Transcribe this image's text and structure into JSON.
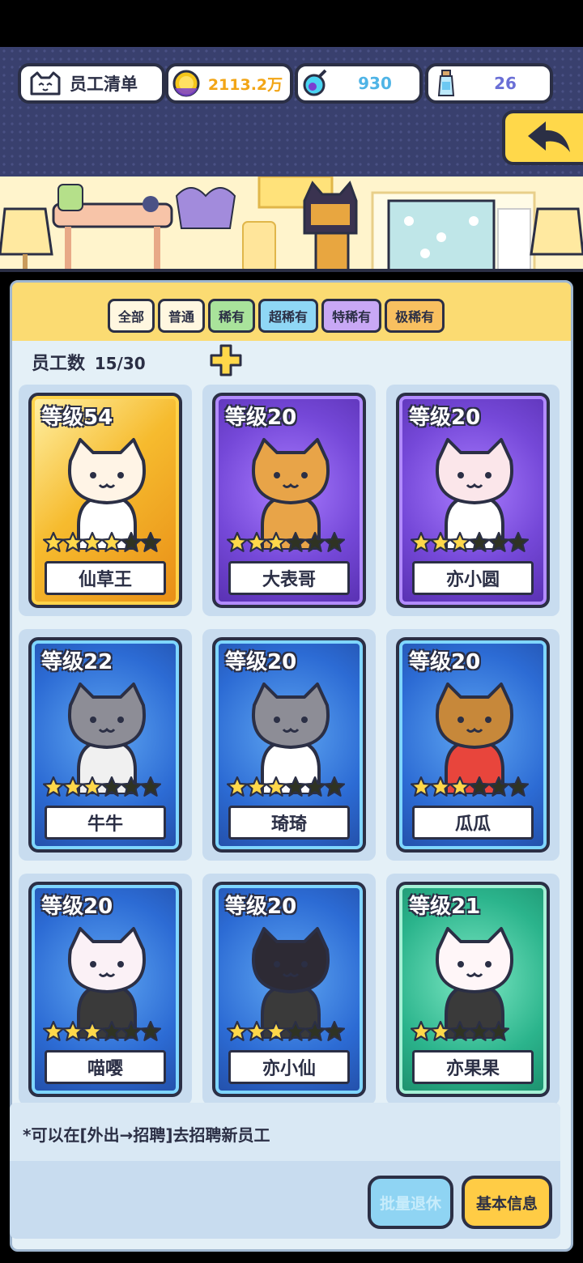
{
  "header": {
    "title": "员工清单",
    "gold": "2113.2万",
    "gems": "930",
    "bottles": "26"
  },
  "tabs": [
    {
      "label": "全部",
      "color": "#fff7e0"
    },
    {
      "label": "普通",
      "color": "#fff7e0"
    },
    {
      "label": "稀有",
      "color": "#a9e39b"
    },
    {
      "label": "超稀有",
      "color": "#8fd7f5"
    },
    {
      "label": "特稀有",
      "color": "#c8a8f5"
    },
    {
      "label": "极稀有",
      "color": "#f8c060"
    }
  ],
  "staff": {
    "label": "员工数",
    "count": "15/30"
  },
  "cards": [
    {
      "level": "等级54",
      "name": "仙草王",
      "rarity": "legend",
      "stars": 4,
      "max_stars": 6
    },
    {
      "level": "等级20",
      "name": "大表哥",
      "rarity": "epic",
      "stars": 3,
      "max_stars": 6
    },
    {
      "level": "等级20",
      "name": "亦小圆",
      "rarity": "epic",
      "stars": 3,
      "max_stars": 6
    },
    {
      "level": "等级22",
      "name": "牛牛",
      "rarity": "rare",
      "stars": 3,
      "max_stars": 6
    },
    {
      "level": "等级20",
      "name": "琦琦",
      "rarity": "rare",
      "stars": 3,
      "max_stars": 6
    },
    {
      "level": "等级20",
      "name": "瓜瓜",
      "rarity": "rare",
      "stars": 3,
      "max_stars": 6
    },
    {
      "level": "等级20",
      "name": "喵嘤",
      "rarity": "rare",
      "stars": 3,
      "max_stars": 6
    },
    {
      "level": "等级20",
      "name": "亦小仙",
      "rarity": "rare",
      "stars": 3,
      "max_stars": 6
    },
    {
      "level": "等级21",
      "name": "亦果果",
      "rarity": "green",
      "stars": 2,
      "max_stars": 5
    }
  ],
  "footer": {
    "hint": "*可以在[外出→招聘]去招聘新员工",
    "retire_label": "批量退休",
    "info_label": "基本信息"
  }
}
